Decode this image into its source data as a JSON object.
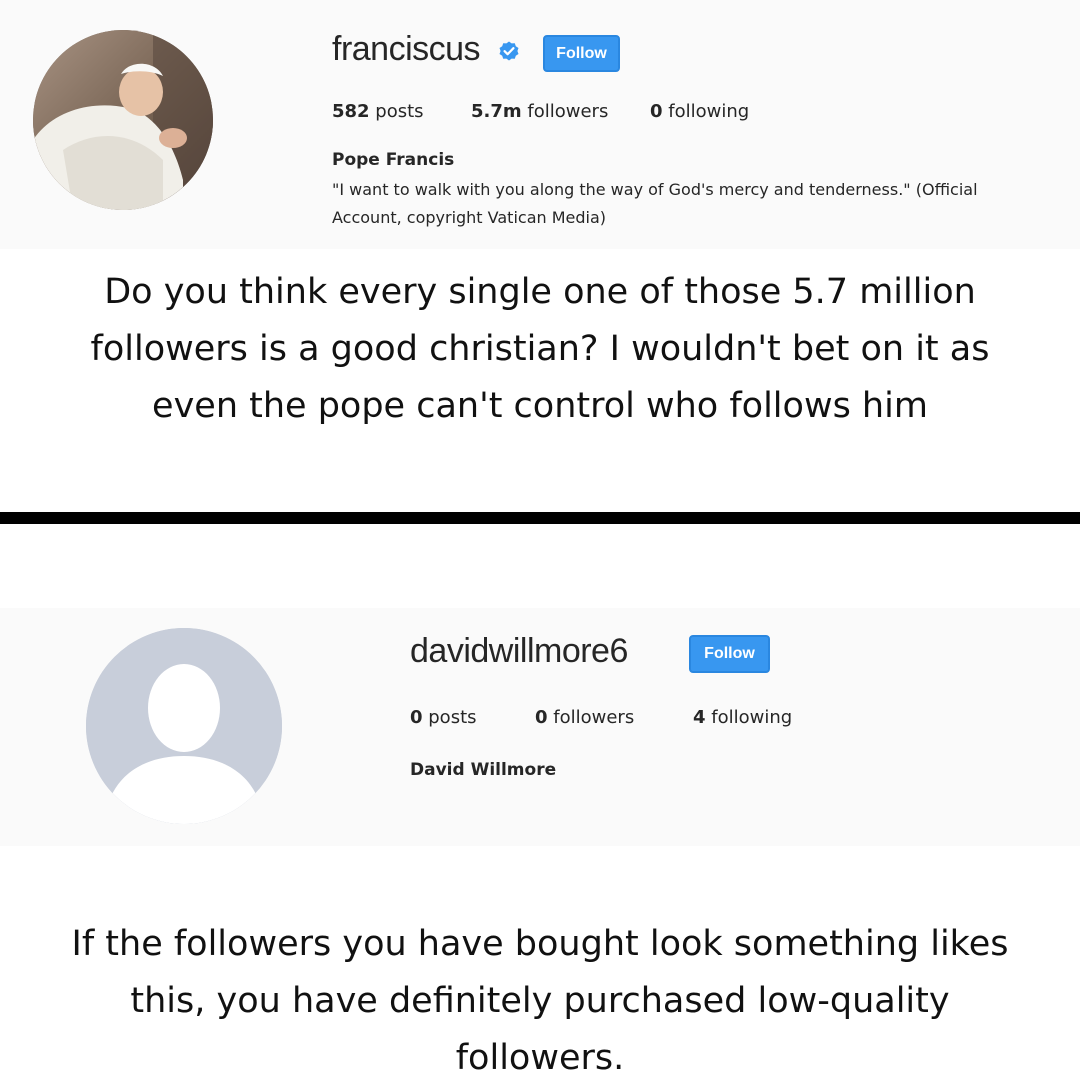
{
  "profile1": {
    "username": "franciscus",
    "verified": true,
    "follow_label": "Follow",
    "stats": {
      "posts_count": "582",
      "posts_label": " posts",
      "followers_count": "5.7m",
      "followers_label": " followers",
      "following_count": "0",
      "following_label": " following"
    },
    "full_name": "Pope Francis",
    "bio_line1": "\"I want to walk with you along the way of God's mercy and tenderness.\" (Official",
    "bio_line2": "Account, copyright Vatican Media)"
  },
  "caption1": {
    "line1": "Do you think every single one of those 5.7 million",
    "line2": "followers is a good christian? I wouldn't bet on it as",
    "line3": "even the pope can't control who follows him"
  },
  "profile2": {
    "username": "davidwillmore6",
    "follow_label": "Follow",
    "stats": {
      "posts_count": "0",
      "posts_label": " posts",
      "followers_count": "0",
      "followers_label": " followers",
      "following_count": "4",
      "following_label": " following"
    },
    "full_name": "David Willmore"
  },
  "caption2": {
    "line1": "If the followers you have bought look something likes",
    "line2": "this, you have definitely purchased low-quality",
    "line3": "followers."
  },
  "colors": {
    "follow_blue": "#3897f0",
    "profile_bg": "#fafafa",
    "placeholder_avatar": "#c8ceda"
  },
  "icons": {
    "verified": "verified-badge-icon",
    "default_avatar": "default-user-silhouette-icon"
  }
}
